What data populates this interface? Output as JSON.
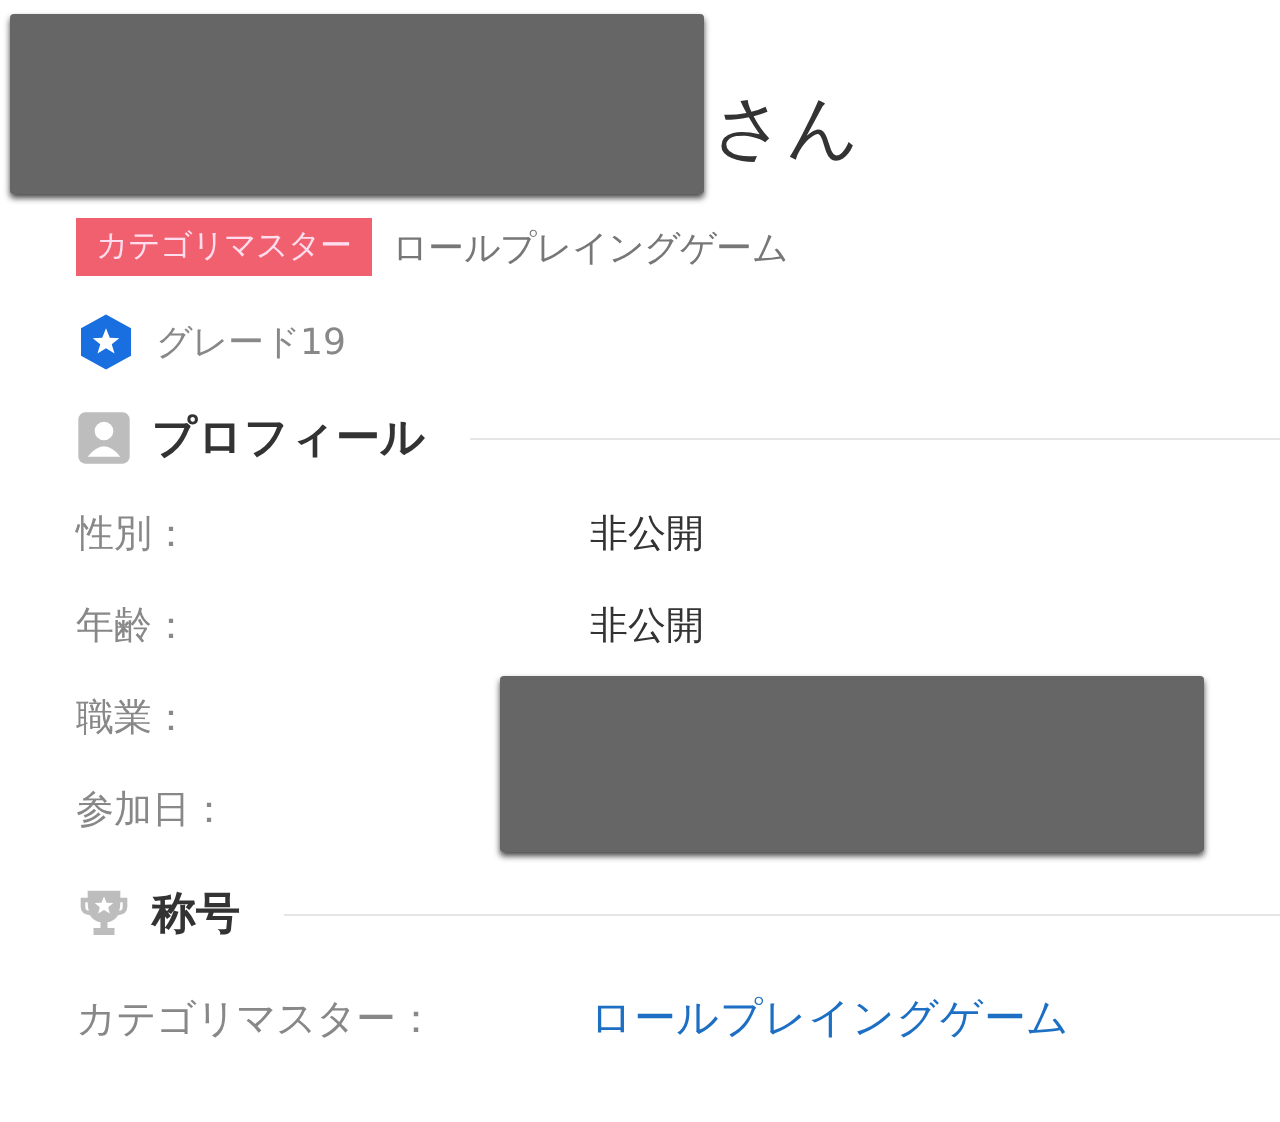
{
  "user": {
    "name_suffix": "さん",
    "badge": "カテゴリマスター",
    "badge_category": "ロールプレイングゲーム",
    "grade": "グレード19"
  },
  "profile": {
    "heading": "プロフィール",
    "rows": [
      {
        "label": "性別：",
        "value": "非公開"
      },
      {
        "label": "年齢：",
        "value": "非公開"
      },
      {
        "label": "職業："
      },
      {
        "label": "参加日："
      }
    ]
  },
  "titles": {
    "heading": "称号",
    "rows": [
      {
        "label": "カテゴリマスター：",
        "link": "ロールプレイングゲーム"
      }
    ]
  }
}
